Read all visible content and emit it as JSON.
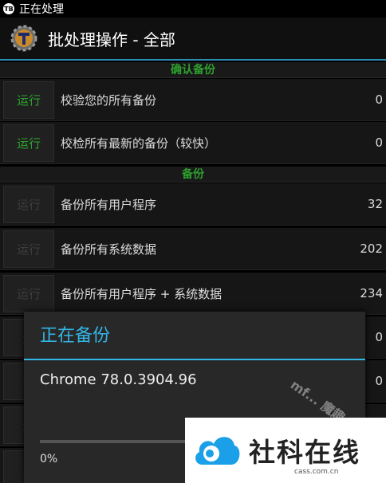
{
  "status": {
    "icon_text": "TB",
    "text": "正在处理"
  },
  "header": {
    "title": "批处理操作 - 全部",
    "icon": "titanium-backup-icon"
  },
  "sections": [
    {
      "title": "确认备份",
      "rows": [
        {
          "button": "运行",
          "label": "校验您的所有备份",
          "count": "0"
        },
        {
          "button": "运行",
          "label": "校检所有最新的备份（较快）",
          "count": "0"
        }
      ]
    },
    {
      "title": "备份",
      "rows": [
        {
          "button": "运行",
          "label": "备份所有用户程序",
          "count": "32"
        },
        {
          "button": "运行",
          "label": "备份所有系统数据",
          "count": "202"
        },
        {
          "button": "运行",
          "label": "备份所有用户程序 + 系统数据",
          "count": "234"
        },
        {
          "button": "运",
          "label": "",
          "count": "0"
        },
        {
          "button": "运",
          "label": "",
          "count": "0"
        },
        {
          "button": "运",
          "label": "",
          "count": ""
        },
        {
          "button": "运",
          "label": "",
          "count": ""
        }
      ]
    }
  ],
  "dialog": {
    "title": "正在备份",
    "message": "Chrome 78.0.3904.96",
    "progress_fraction": 0,
    "progress_text": "0%"
  },
  "watermark": {
    "text": "mf... 魔趣"
  },
  "logo": {
    "main": "社科在线",
    "sub": "cass.com.cn",
    "color": "#1a9fe8"
  },
  "colors": {
    "accent": "#33b5e5",
    "run_green": "#2fa12f",
    "section_green": "#2ea02e"
  }
}
